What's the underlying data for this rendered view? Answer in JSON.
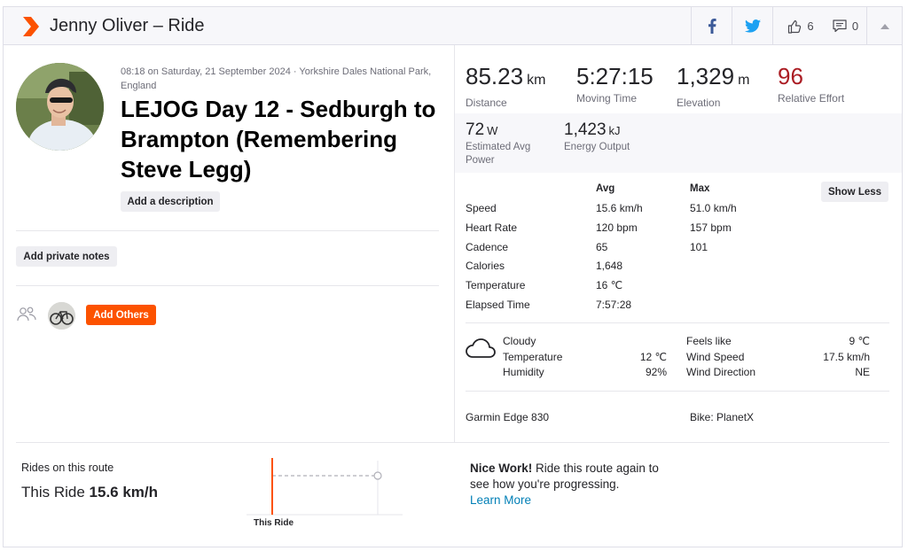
{
  "header": {
    "title": "Jenny Oliver – Ride",
    "kudos_count": "6",
    "comment_count": "0"
  },
  "activity": {
    "meta": "08:18 on Saturday, 21 September 2024 · Yorkshire Dales National Park, England",
    "name": "LEJOG Day 12 - Sedburgh to Brampton (Remembering Steve Legg)",
    "add_description_label": "Add a description",
    "add_private_notes_label": "Add private notes",
    "add_others_label": "Add Others"
  },
  "stats": {
    "distance": {
      "value": "85.23",
      "unit": "km",
      "label": "Distance"
    },
    "moving_time": {
      "value": "5:27:15",
      "label": "Moving Time"
    },
    "elevation": {
      "value": "1,329",
      "unit": "m",
      "label": "Elevation"
    },
    "relative_effort": {
      "value": "96",
      "label": "Relative Effort"
    },
    "power": {
      "value": "72",
      "unit": "W",
      "label": "Estimated Avg Power"
    },
    "energy": {
      "value": "1,423",
      "unit": "kJ",
      "label": "Energy Output"
    }
  },
  "details": {
    "avg_header": "Avg",
    "max_header": "Max",
    "show_less_label": "Show Less",
    "rows": [
      {
        "label": "Speed",
        "avg": "15.6 km/h",
        "max": "51.0 km/h"
      },
      {
        "label": "Heart Rate",
        "avg": "120 bpm",
        "max": "157 bpm"
      },
      {
        "label": "Cadence",
        "avg": "65",
        "max": "101"
      },
      {
        "label": "Calories",
        "avg": "1,648",
        "max": ""
      },
      {
        "label": "Temperature",
        "avg": "16 ℃",
        "max": ""
      },
      {
        "label": "Elapsed Time",
        "avg": "7:57:28",
        "max": ""
      }
    ]
  },
  "weather": {
    "condition": "Cloudy",
    "temperature_label": "Temperature",
    "temperature_value": "12 ℃",
    "humidity_label": "Humidity",
    "humidity_value": "92%",
    "feels_like_label": "Feels like",
    "feels_like_value": "9 ℃",
    "wind_speed_label": "Wind Speed",
    "wind_speed_value": "17.5 km/h",
    "wind_direction_label": "Wind Direction",
    "wind_direction_value": "NE"
  },
  "gear": {
    "device": "Garmin Edge 830",
    "bike": "Bike: PlanetX"
  },
  "route": {
    "rides_label": "Rides on this route",
    "this_ride_prefix": "This Ride",
    "this_ride_value": "15.6 km/h",
    "chart_label": "This Ride",
    "nice_work_bold": "Nice Work!",
    "nice_work_text": " Ride this route again to see how you're progressing.",
    "learn_more": "Learn More"
  },
  "colors": {
    "brand_orange": "#fc5200",
    "relative_effort_red": "#ab1d24",
    "link_blue": "#007fb6",
    "facebook_blue": "#3b5998",
    "twitter_blue": "#1da1f2"
  }
}
